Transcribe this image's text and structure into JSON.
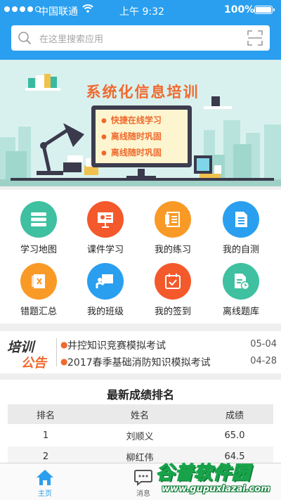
{
  "status_bar": {
    "carrier": "中国联通",
    "time": "上午 9:32",
    "battery": "100%"
  },
  "search": {
    "placeholder": "在这里搜索应用",
    "icon": "search-icon",
    "scan_icon": "scan-icon"
  },
  "banner": {
    "title": "系统化信息培训",
    "points": [
      "快捷在线学习",
      "离线随时巩固",
      "离线随时巩固"
    ]
  },
  "menu": [
    {
      "label": "学习地图",
      "icon": "map-stack-icon",
      "color": "#3fc0a0"
    },
    {
      "label": "课件学习",
      "icon": "presentation-icon",
      "color": "#f4592b"
    },
    {
      "label": "我的练习",
      "icon": "notebook-icon",
      "color": "#f99a26"
    },
    {
      "label": "我的自测",
      "icon": "document-icon",
      "color": "#2a9fef"
    },
    {
      "label": "错题汇总",
      "icon": "error-book-icon",
      "color": "#f99a26"
    },
    {
      "label": "我的班级",
      "icon": "teacher-board-icon",
      "color": "#2a9fef"
    },
    {
      "label": "我的签到",
      "icon": "calendar-check-icon",
      "color": "#f4592b"
    },
    {
      "label": "离线题库",
      "icon": "offline-file-icon",
      "color": "#3fc0a0"
    }
  ],
  "notice": {
    "logo_top": "培训",
    "logo_bottom": "公告",
    "items": [
      {
        "title": "井控知识竞赛模拟考试",
        "date": "05-04"
      },
      {
        "title": "2017春季基础消防知识模拟考试",
        "date": "04-28"
      }
    ]
  },
  "ranking": {
    "title": "最新成绩排名",
    "headers": [
      "排名",
      "姓名",
      "成绩"
    ],
    "rows": [
      [
        "1",
        "刘顺义",
        "65.0"
      ],
      [
        "2",
        "柳红伟",
        "64.5"
      ]
    ]
  },
  "tabbar": {
    "tabs": [
      {
        "label": "主页",
        "icon": "home-icon",
        "active": true
      },
      {
        "label": "消息",
        "icon": "message-icon",
        "active": false
      }
    ],
    "active_color": "#2a9fef",
    "inactive_color": "#666666"
  },
  "watermark": {
    "name": "谷普软件园",
    "url": "www.gupuxlazai.com"
  }
}
